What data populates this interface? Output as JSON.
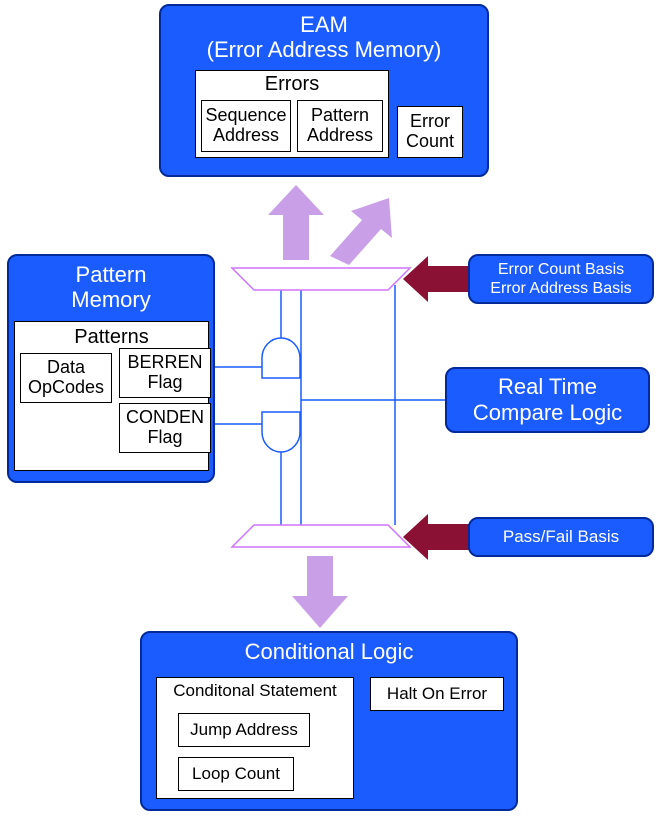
{
  "eam": {
    "title_line1": "EAM",
    "title_line2": "(Error Address Memory)",
    "errors_head": "Errors",
    "seq_addr_line1": "Sequence",
    "seq_addr_line2": "Address",
    "pat_addr_line1": "Pattern",
    "pat_addr_line2": "Address",
    "err_count_line1": "Error",
    "err_count_line2": "Count"
  },
  "pattern_memory": {
    "title_line1": "Pattern",
    "title_line2": "Memory",
    "patterns_head": "Patterns",
    "data_line1": "Data",
    "data_line2": "OpCodes",
    "berren_line1": "BERREN",
    "berren_line2": "Flag",
    "conden_line1": "CONDEN",
    "conden_line2": "Flag"
  },
  "labels": {
    "err_basis_line1": "Error Count Basis",
    "err_basis_line2": "Error Address Basis",
    "compare_line1": "Real Time",
    "compare_line2": "Compare Logic",
    "passfail": "Pass/Fail Basis"
  },
  "conditional": {
    "title": "Conditional Logic",
    "stmt_head": "Conditonal Statement",
    "jump": "Jump Address",
    "loop": "Loop Count",
    "halt": "Halt On Error"
  }
}
